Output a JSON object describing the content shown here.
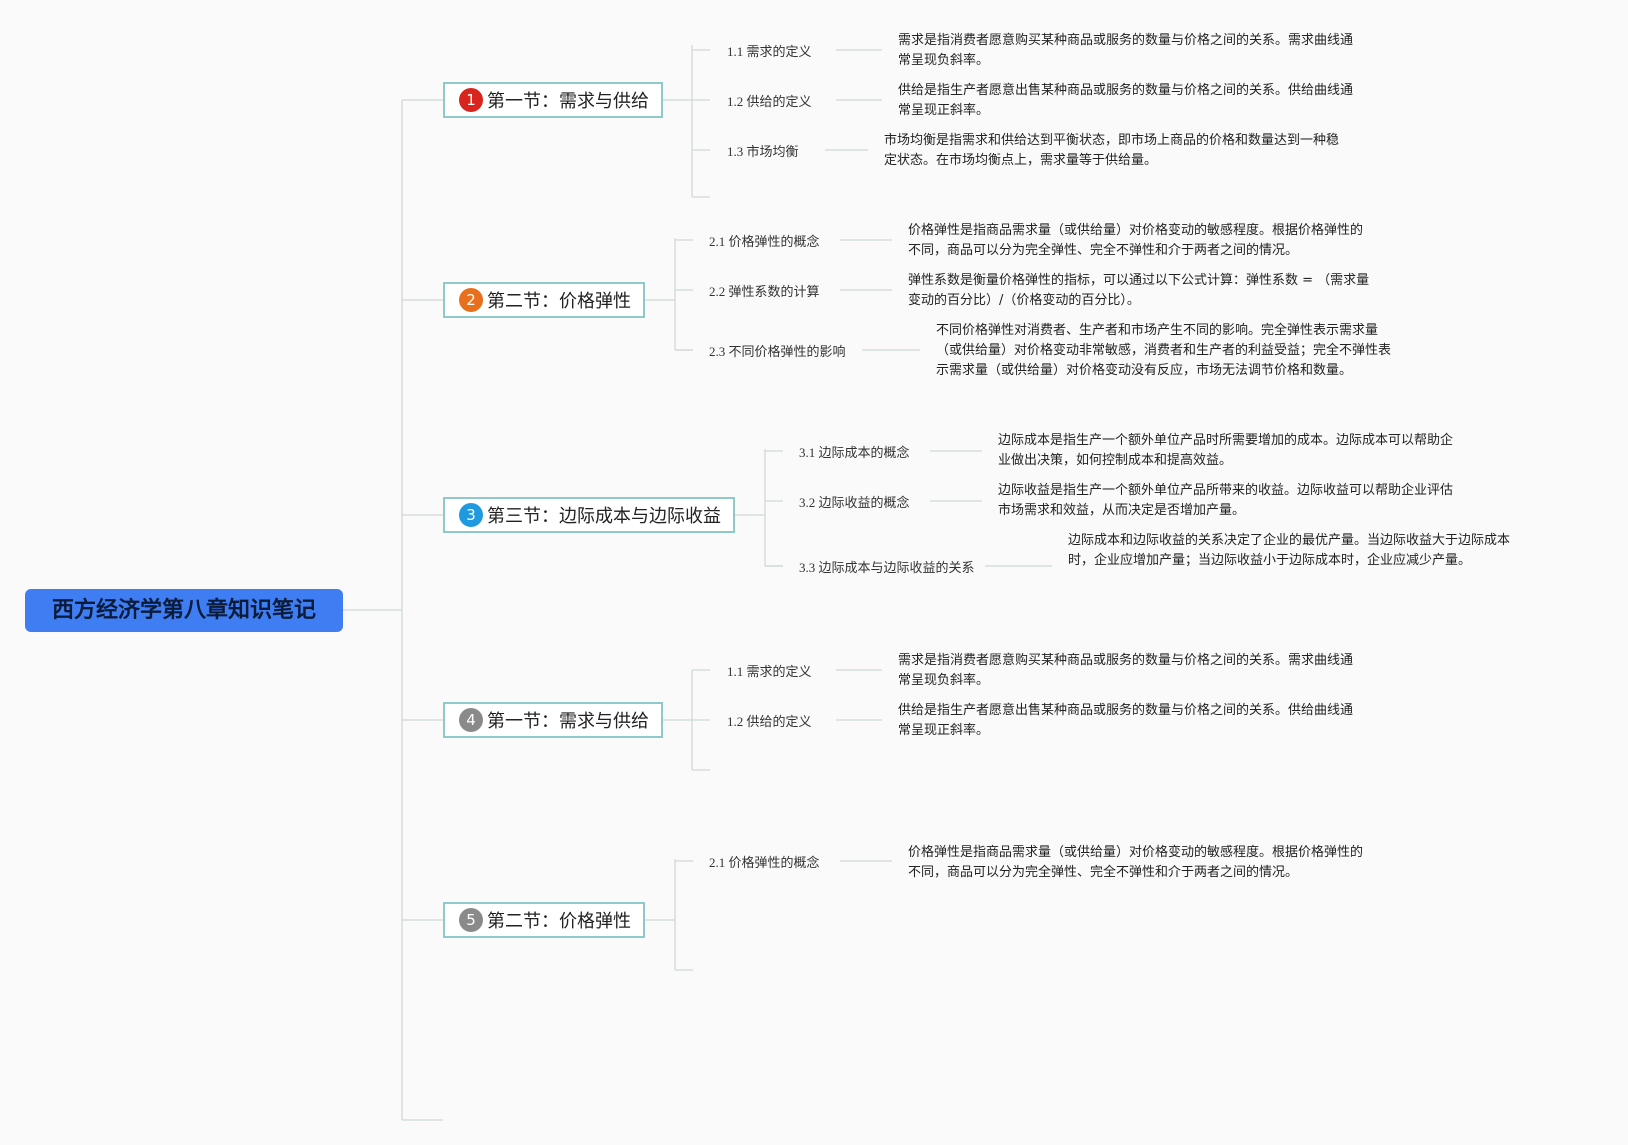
{
  "root": {
    "title": "西方经济学第八章知识笔记"
  },
  "sections": [
    {
      "number": "1",
      "color": "#d8251d",
      "title": "第一节：需求与供给",
      "items": [
        {
          "label": "1.1 需求的定义",
          "desc": [
            "需求是指消费者愿意购买某种商品或服务的数量与价格之间的关系。需求曲线通",
            "常呈现负斜率。"
          ]
        },
        {
          "label": "1.2 供给的定义",
          "desc": [
            "供给是指生产者愿意出售某种商品或服务的数量与价格之间的关系。供给曲线通",
            "常呈现正斜率。"
          ]
        },
        {
          "label": "1.3 市场均衡",
          "desc": [
            "市场均衡是指需求和供给达到平衡状态，即市场上商品的价格和数量达到一种稳",
            "定状态。在市场均衡点上，需求量等于供给量。"
          ]
        }
      ]
    },
    {
      "number": "2",
      "color": "#e8701c",
      "title": "第二节：价格弹性",
      "items": [
        {
          "label": "2.1 价格弹性的概念",
          "desc": [
            "价格弹性是指商品需求量（或供给量）对价格变动的敏感程度。根据价格弹性的",
            "不同，商品可以分为完全弹性、完全不弹性和介于两者之间的情况。"
          ]
        },
        {
          "label": "2.2 弹性系数的计算",
          "desc": [
            "弹性系数是衡量价格弹性的指标，可以通过以下公式计算：弹性系数 = （需求量",
            "变动的百分比）/（价格变动的百分比）。"
          ]
        },
        {
          "label": "2.3 不同价格弹性的影响",
          "desc": [
            "不同价格弹性对消费者、生产者和市场产生不同的影响。完全弹性表示需求量",
            "（或供给量）对价格变动非常敏感，消费者和生产者的利益受益；完全不弹性表",
            "示需求量（或供给量）对价格变动没有反应，市场无法调节价格和数量。"
          ]
        }
      ]
    },
    {
      "number": "3",
      "color": "#1f9ae0",
      "title": "第三节：边际成本与边际收益",
      "items": [
        {
          "label": "3.1 边际成本的概念",
          "desc": [
            "边际成本是指生产一个额外单位产品时所需要增加的成本。边际成本可以帮助企",
            "业做出决策，如何控制成本和提高效益。"
          ]
        },
        {
          "label": "3.2 边际收益的概念",
          "desc": [
            "边际收益是指生产一个额外单位产品所带来的收益。边际收益可以帮助企业评估",
            "市场需求和效益，从而决定是否增加产量。"
          ]
        },
        {
          "label": "3.3 边际成本与边际收益的关系",
          "desc": [
            "边际成本和边际收益的关系决定了企业的最优产量。当边际收益大于边际成本",
            "时，企业应增加产量；当边际收益小于边际成本时，企业应减少产量。"
          ]
        }
      ]
    },
    {
      "number": "4",
      "color": "#8a8a8a",
      "title": "第一节：需求与供给",
      "items": [
        {
          "label": "1.1 需求的定义",
          "desc": [
            "需求是指消费者愿意购买某种商品或服务的数量与价格之间的关系。需求曲线通",
            "常呈现负斜率。"
          ]
        },
        {
          "label": "1.2 供给的定义",
          "desc": [
            "供给是指生产者愿意出售某种商品或服务的数量与价格之间的关系。供给曲线通",
            "常呈现正斜率。"
          ]
        }
      ]
    },
    {
      "number": "5",
      "color": "#8a8a8a",
      "title": "第二节：价格弹性",
      "items": [
        {
          "label": "2.1 价格弹性的概念",
          "desc": [
            "价格弹性是指商品需求量（或供给量）对价格变动的敏感程度。根据价格弹性的",
            "不同，商品可以分为完全弹性、完全不弹性和介于两者之间的情况。"
          ]
        }
      ]
    }
  ]
}
